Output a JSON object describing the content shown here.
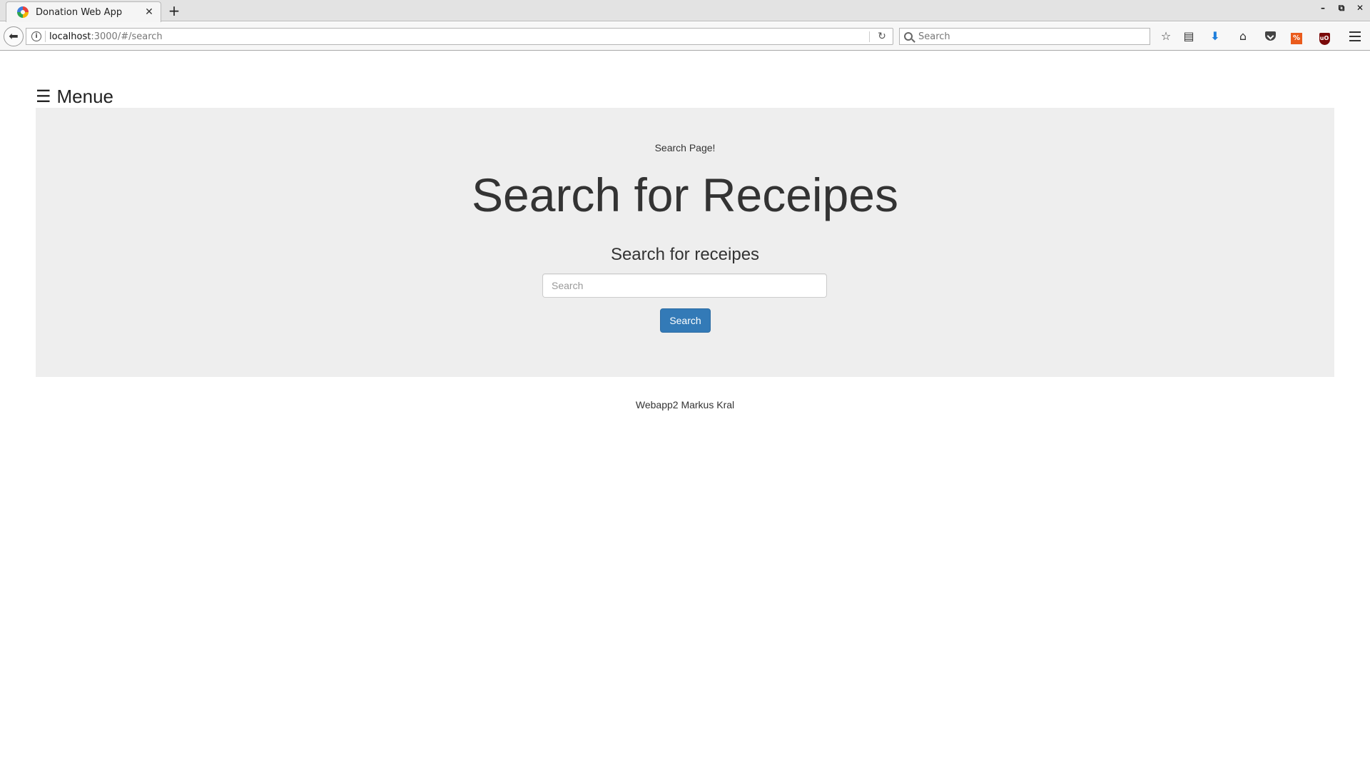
{
  "browser": {
    "tab_title": "Donation Web App",
    "tab_close": "✕",
    "new_tab": "+",
    "url_host": "localhost",
    "url_path": ":3000/#/search",
    "search_placeholder": "Search",
    "window_controls": {
      "minimize": "–",
      "restore": "⧉",
      "close": "✕"
    },
    "toolbar_icons": [
      "bookmark-star-icon",
      "reading-list-icon",
      "download-icon",
      "home-icon",
      "pocket-icon",
      "extension-icon",
      "ublock-icon",
      "hamburger-menu-icon"
    ]
  },
  "page": {
    "menu_label": "Menue",
    "jumbotron": {
      "subtitle": "Search Page!",
      "title": "Search for Receipes",
      "form_heading": "Search for receipes",
      "input_placeholder": "Search",
      "button_label": "Search"
    },
    "footer": "Webapp2 Markus Kral"
  },
  "colors": {
    "primary_button": "#337ab7",
    "jumbotron_bg": "#eeeeee"
  }
}
